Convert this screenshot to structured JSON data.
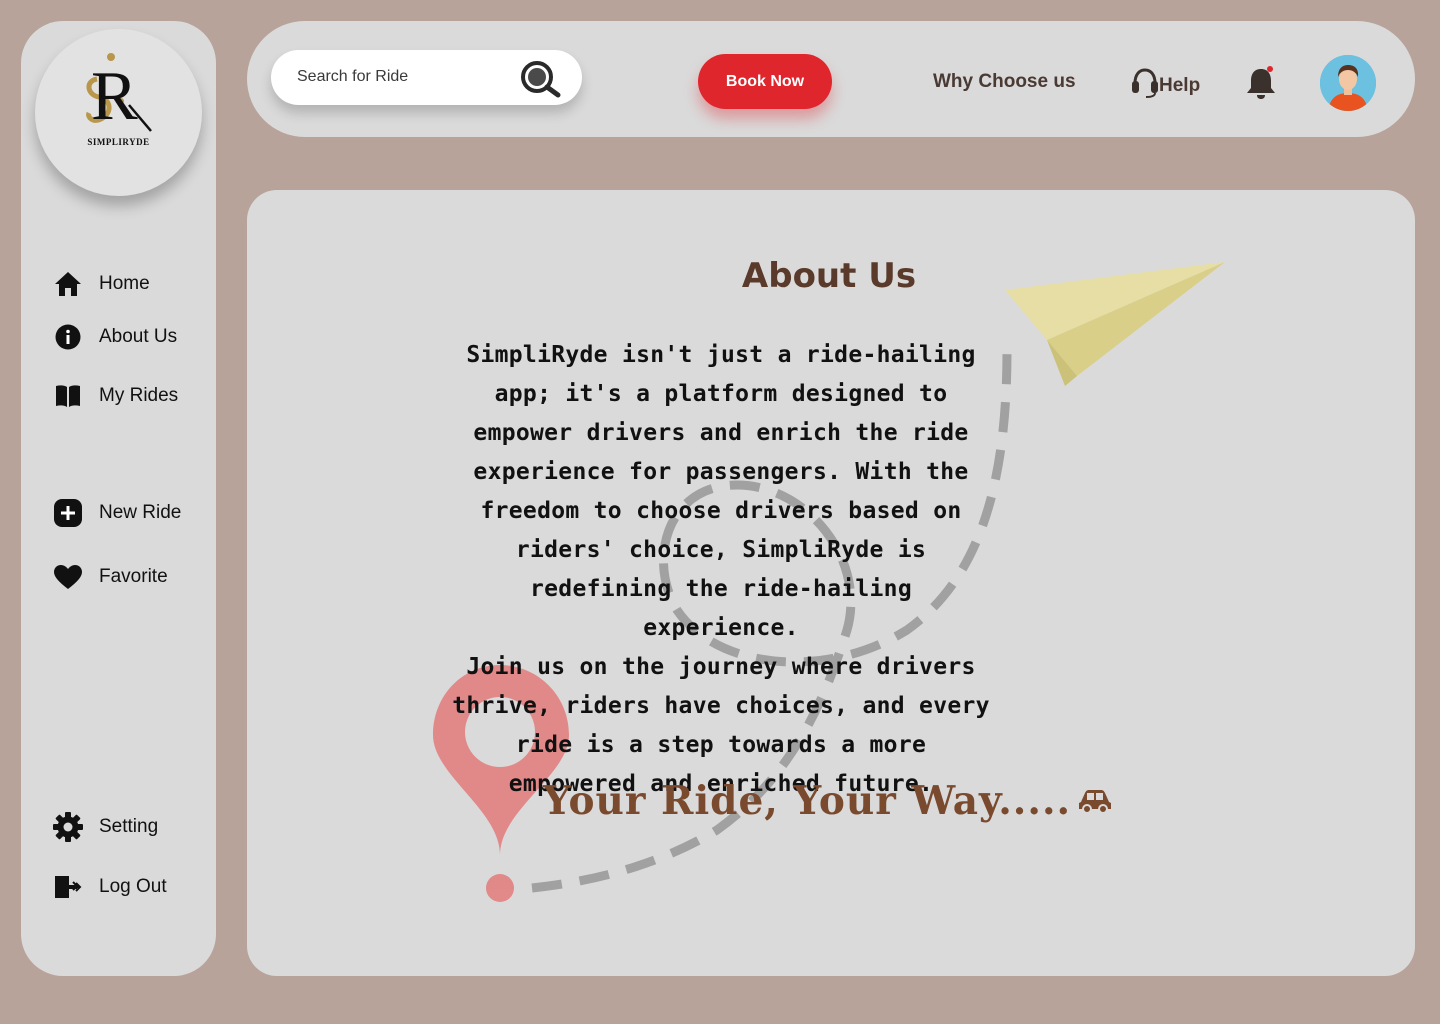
{
  "brand": {
    "logo_letters": "SR",
    "name": "SIMPLIRYDE"
  },
  "sidebar": {
    "items": [
      {
        "label": "Home",
        "icon": "home-icon"
      },
      {
        "label": "About Us",
        "icon": "info-icon"
      },
      {
        "label": "My Rides",
        "icon": "book-icon"
      },
      {
        "label": "New Ride",
        "icon": "plus-icon"
      },
      {
        "label": "Favorite",
        "icon": "heart-icon"
      },
      {
        "label": "Setting",
        "icon": "gear-icon"
      },
      {
        "label": "Log Out",
        "icon": "logout-icon"
      }
    ]
  },
  "header": {
    "search_placeholder": "Search for Ride",
    "book_label": "Book Now",
    "why_label": "Why Choose us",
    "help_label": "Help"
  },
  "main": {
    "title": "About Us",
    "paragraph1": "SimpliRyde isn't just a ride-hailing app; it's a platform designed to empower drivers and enrich the ride experience for passengers. With the freedom to choose drivers based on riders' choice, SimpliRyde is redefining the ride-hailing experience.",
    "paragraph2": "Join us on the journey where drivers thrive, riders have choices, and every ride is a step towards a more empowered and enriched future.",
    "tagline": "Your Ride, Your Way....."
  },
  "colors": {
    "background": "#b8a39a",
    "panel": "#dadada",
    "accent_red": "#e0262d",
    "title_brown": "#5a3a2a",
    "tagline_brown": "#7a4a2e",
    "logo_gold": "#b8964a"
  }
}
